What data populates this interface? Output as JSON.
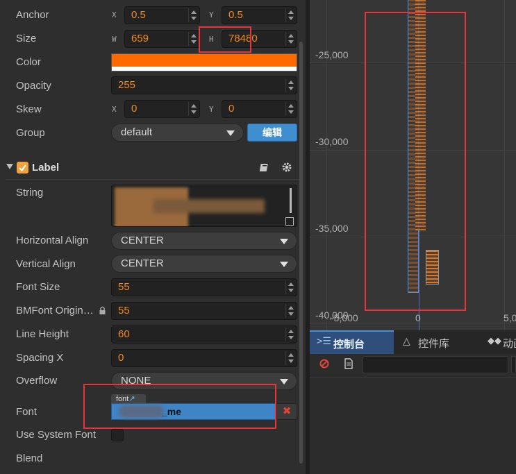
{
  "inspector": {
    "anchor": {
      "label": "Anchor",
      "x_axis": "X",
      "x": "0.5",
      "y_axis": "Y",
      "y": "0.5"
    },
    "size": {
      "label": "Size",
      "w_axis": "W",
      "w": "659",
      "h_axis": "H",
      "h": "78480"
    },
    "color": {
      "label": "Color",
      "value": "#ff6a00"
    },
    "opacity": {
      "label": "Opacity",
      "value": "255"
    },
    "skew": {
      "label": "Skew",
      "x_axis": "X",
      "x": "0",
      "y_axis": "Y",
      "y": "0"
    },
    "group": {
      "label": "Group",
      "value": "default",
      "edit_button": "编辑"
    },
    "label_component": {
      "title": "Label",
      "enabled": true
    },
    "string": {
      "label": "String"
    },
    "horizontal_align": {
      "label": "Horizontal Align",
      "value": "CENTER"
    },
    "vertical_align": {
      "label": "Vertical Align",
      "value": "CENTER"
    },
    "font_size": {
      "label": "Font Size",
      "value": "55"
    },
    "bmfont_original_size": {
      "label": "BMFont Origin…",
      "value": "55"
    },
    "line_height": {
      "label": "Line Height",
      "value": "60"
    },
    "spacing_x": {
      "label": "Spacing X",
      "value": "0"
    },
    "overflow": {
      "label": "Overflow",
      "value": "NONE"
    },
    "font": {
      "label": "Font",
      "tag": "font",
      "value_suffix": "_me"
    },
    "use_system_font": {
      "label": "Use System Font",
      "checked": false
    },
    "blend": {
      "label": "Blend"
    }
  },
  "scene": {
    "y_ticks": [
      "-25,000",
      "-30,000",
      "-35,000",
      "-40,000"
    ],
    "x_ticks": [
      "-5,000",
      "0",
      "5,0"
    ]
  },
  "console": {
    "tabs": [
      {
        "label": "控制台",
        "icon": "terminal-icon",
        "active": true
      },
      {
        "label": "控件库",
        "icon": "widget-library-icon",
        "active": false
      },
      {
        "label": "动画",
        "icon": "animation-icon",
        "active": false
      }
    ],
    "filter_placeholder": ""
  },
  "colors": {
    "accent_orange": "#f08a24",
    "selection_blue": "#3f84c5",
    "annotation_red": "#e8353a"
  }
}
